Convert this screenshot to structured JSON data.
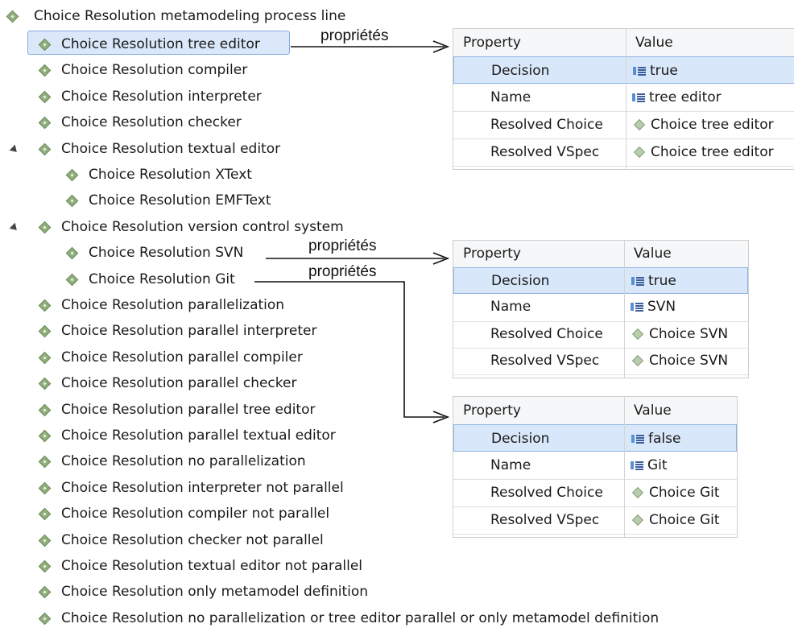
{
  "tree": {
    "root_label": "Choice Resolution metamodeling process line",
    "items": [
      "Choice Resolution tree editor",
      "Choice Resolution compiler",
      "Choice Resolution interpreter",
      "Choice Resolution checker",
      "Choice Resolution textual editor",
      "Choice Resolution XText",
      "Choice Resolution EMFText",
      "Choice Resolution version control system",
      "Choice Resolution SVN",
      "Choice Resolution Git",
      "Choice Resolution parallelization",
      "Choice Resolution parallel interpreter",
      "Choice Resolution parallel compiler",
      "Choice Resolution parallel checker",
      "Choice Resolution parallel tree editor",
      "Choice Resolution parallel textual editor",
      "Choice Resolution no parallelization",
      "Choice Resolution interpreter not parallel",
      "Choice Resolution compiler not parallel",
      "Choice Resolution checker not parallel",
      "Choice Resolution textual editor not parallel",
      "Choice Resolution only metamodel definition",
      "Choice Resolution no parallelization or tree editor parallel or only metamodel definition"
    ]
  },
  "annotations": {
    "tree_editor": "propriétés",
    "svn": "propriétés",
    "git": "propriétés"
  },
  "tables": [
    {
      "header": {
        "property": "Property",
        "value": "Value"
      },
      "rows": [
        {
          "property": "Decision",
          "value": "true",
          "icon": "attribute-icon"
        },
        {
          "property": "Name",
          "value": "tree editor",
          "icon": "attribute-icon"
        },
        {
          "property": "Resolved Choice",
          "value": "Choice tree editor",
          "icon": "reference-icon"
        },
        {
          "property": "Resolved VSpec",
          "value": "Choice tree editor",
          "icon": "reference-icon"
        }
      ]
    },
    {
      "header": {
        "property": "Property",
        "value": "Value"
      },
      "rows": [
        {
          "property": "Decision",
          "value": "true",
          "icon": "attribute-icon"
        },
        {
          "property": "Name",
          "value": "SVN",
          "icon": "attribute-icon"
        },
        {
          "property": "Resolved Choice",
          "value": "Choice SVN",
          "icon": "reference-icon"
        },
        {
          "property": "Resolved VSpec",
          "value": "Choice SVN",
          "icon": "reference-icon"
        }
      ]
    },
    {
      "header": {
        "property": "Property",
        "value": "Value"
      },
      "rows": [
        {
          "property": "Decision",
          "value": "false",
          "icon": "attribute-icon"
        },
        {
          "property": "Name",
          "value": "Git",
          "icon": "attribute-icon"
        },
        {
          "property": "Resolved Choice",
          "value": "Choice Git",
          "icon": "reference-icon"
        },
        {
          "property": "Resolved VSpec",
          "value": "Choice Git",
          "icon": "reference-icon"
        }
      ]
    }
  ],
  "colors": {
    "selection": "#dae8fa",
    "selection_border": "#84acdd",
    "icon_green": "#8fae7c"
  }
}
